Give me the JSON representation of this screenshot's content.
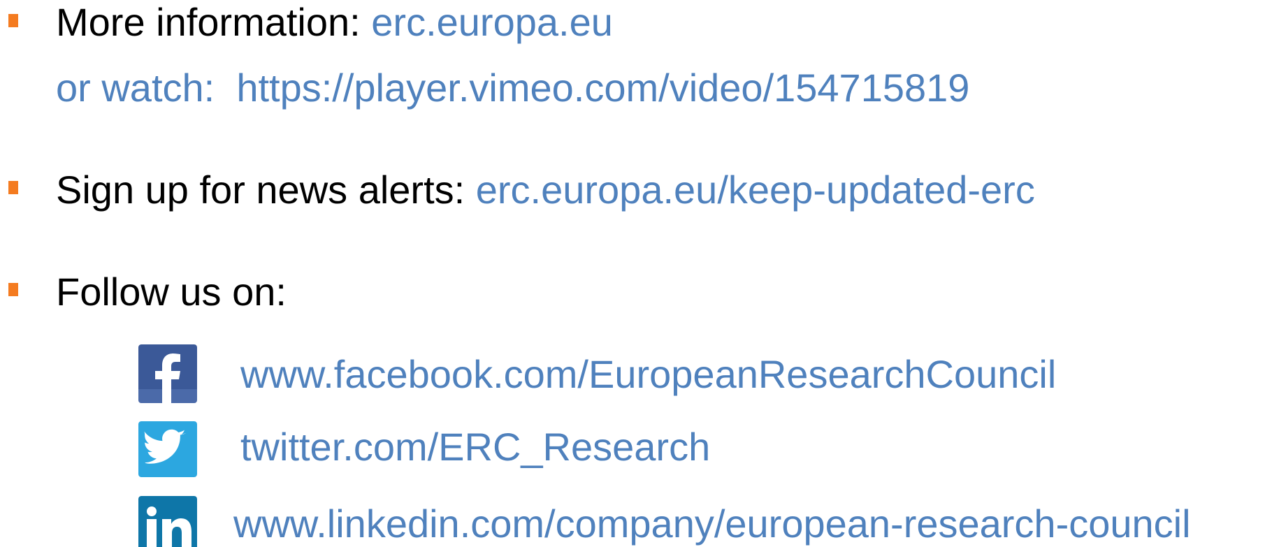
{
  "colors": {
    "text": "#000000",
    "link": "#4f81bd",
    "bullet": "#f47b20",
    "facebook": "#3b5998",
    "twitter": "#2ca7e0",
    "linkedin": "#0e76a8"
  },
  "more_info": {
    "label": "More information: ",
    "link": "erc.europa.eu"
  },
  "watch": {
    "label": "or watch:",
    "link": "https://player.vimeo.com/video/154715819"
  },
  "news_alerts": {
    "label": "Sign up for news alerts: ",
    "link": "erc.europa.eu/keep-updated-erc"
  },
  "follow": {
    "label": "Follow us on:"
  },
  "social": [
    {
      "icon": "facebook-icon",
      "url": "www.facebook.com/EuropeanResearchCouncil"
    },
    {
      "icon": "twitter-icon",
      "url": "twitter.com/ERC_Research"
    },
    {
      "icon": "linkedin-icon",
      "url": "www.linkedin.com/company/european-research-council"
    }
  ]
}
